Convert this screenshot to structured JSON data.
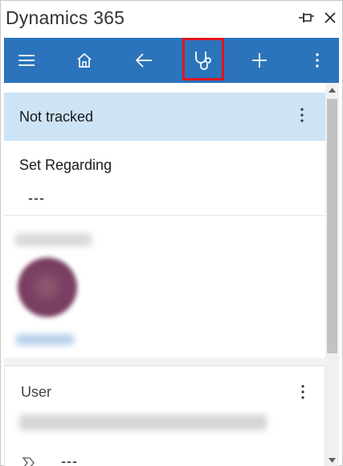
{
  "window": {
    "title": "Dynamics 365"
  },
  "toolbar": {
    "items": [
      "menu-icon",
      "home-icon",
      "back-icon",
      "stethoscope-icon",
      "add-icon",
      "more-icon"
    ],
    "accent_color": "#2b74bb",
    "highlight_color": "#e0141e"
  },
  "tracking": {
    "status": "Not tracked"
  },
  "regarding": {
    "label": "Set Regarding",
    "value": "---"
  },
  "user_card": {
    "label": "User",
    "value": "---"
  }
}
